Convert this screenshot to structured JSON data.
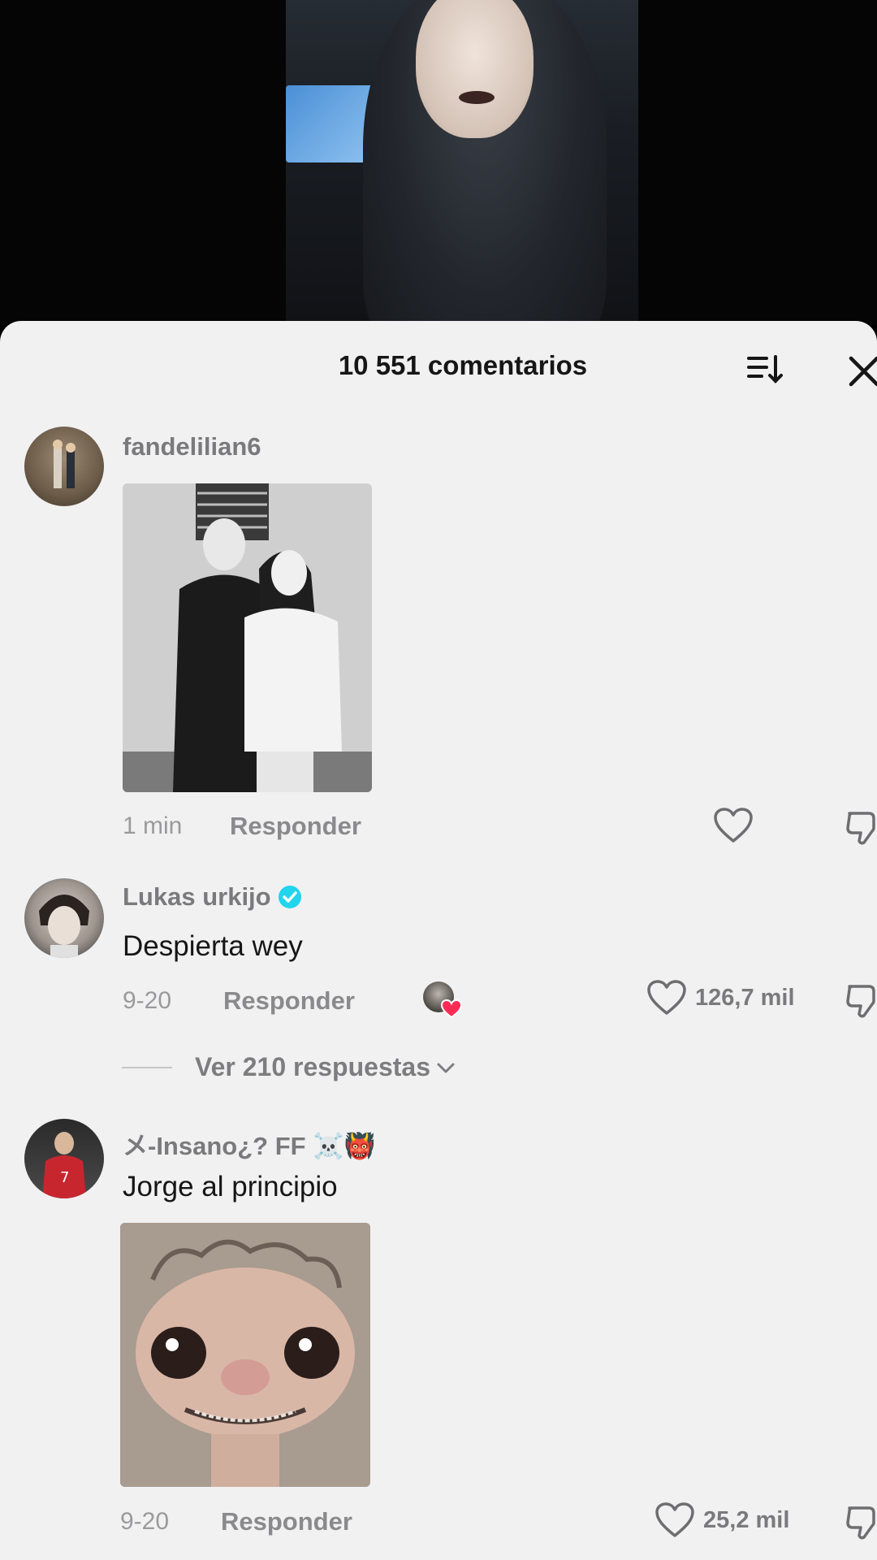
{
  "sheet": {
    "title": "10 551 comentarios"
  },
  "icons": {
    "sort": "sort-icon",
    "close": "close-icon",
    "like": "heart-outline-icon",
    "dislike": "thumbs-down-icon",
    "verified": "verified-badge-icon",
    "chevron": "chevron-down-icon"
  },
  "colors": {
    "accent_verified": "#20d5ec",
    "creator_heart": "#fe2c55",
    "sheet_bg": "#f1f1f2"
  },
  "comments": [
    {
      "username": "fandelilian6",
      "text": "",
      "time": "1 min",
      "reply_label": "Responder",
      "likes": ""
    },
    {
      "username": "Lukas urkijo",
      "text": "Despierta wey",
      "time": "9-20",
      "reply_label": "Responder",
      "likes": "126,7 mil",
      "replies_label": "Ver 210 respuestas"
    },
    {
      "username": "メ-Insano¿? FF ☠️👹",
      "text": "Jorge al principio",
      "time": "9-20",
      "reply_label": "Responder",
      "likes": "25,2 mil"
    }
  ]
}
